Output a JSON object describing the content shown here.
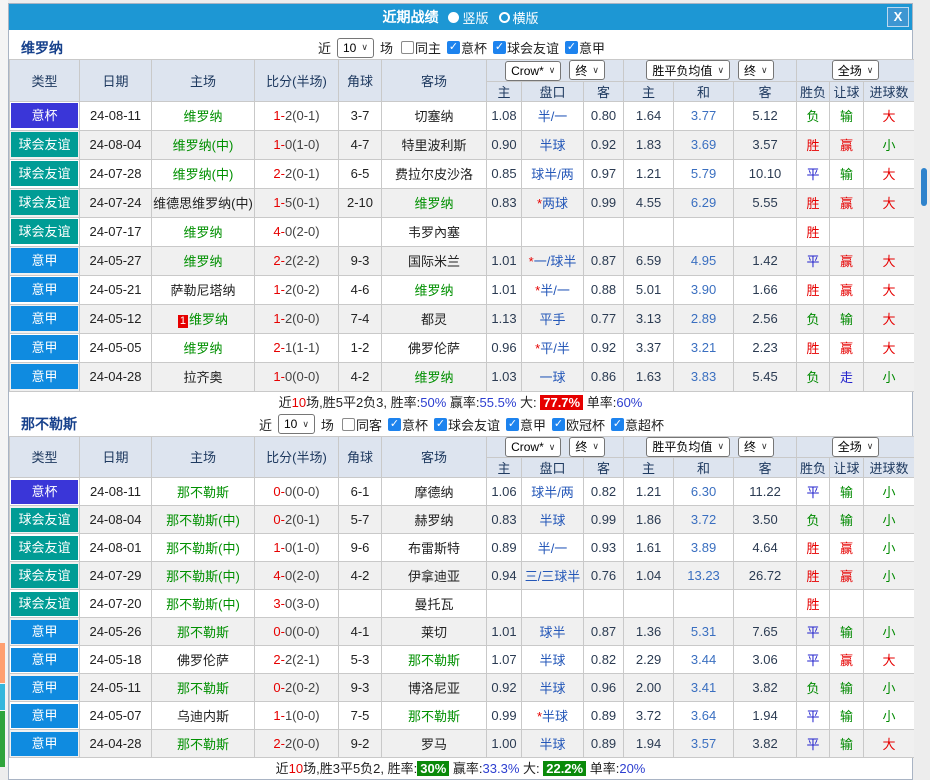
{
  "titlebar": {
    "title": "近期战绩",
    "view_options": [
      {
        "label": "竖版",
        "selected": true
      },
      {
        "label": "横版",
        "selected": false
      }
    ],
    "close_label": "X"
  },
  "table_headers": {
    "left": [
      "类型",
      "日期",
      "主场",
      "比分(半场)",
      "角球",
      "客场"
    ],
    "sub": [
      "主",
      "盘口",
      "客",
      "主",
      "和",
      "客",
      "胜负",
      "让球",
      "进球数"
    ]
  },
  "selects": {
    "odds_company": "Crow*",
    "odds_stage": "终",
    "avg_type": "胜平负均值",
    "avg_stage": "终",
    "scope": "全场"
  },
  "colors": {
    "titlebar": "#1d97d4",
    "badge_cup": "#3a36d8",
    "badge_friendly": "#009c95",
    "badge_league": "#0f8be0",
    "focus_team": "#009000",
    "win": "#e60000",
    "draw": "#2222cc",
    "lose": "#008a00"
  },
  "sections": [
    {
      "team": "维罗纳",
      "filter": {
        "prefix": "近",
        "count": "10",
        "suffix": "场",
        "same_label": "同主",
        "same_checked": false,
        "leagues": [
          {
            "label": "意杯",
            "checked": true
          },
          {
            "label": "球会友谊",
            "checked": true
          },
          {
            "label": "意甲",
            "checked": true
          }
        ]
      },
      "rows": [
        {
          "type": "意杯",
          "date": "24-08-11",
          "home": "维罗纳",
          "home_focus": true,
          "cards": "",
          "score": "1-2(0-1)",
          "corner": "3-7",
          "away": "切塞纳",
          "away_focus": false,
          "o1": "1.08",
          "star": false,
          "hcap": "半/一",
          "o2": "0.80",
          "m1": "1.64",
          "m2": "3.77",
          "m3": "5.12",
          "res": "负",
          "hres": "输",
          "gres": "大"
        },
        {
          "type": "球会友谊",
          "date": "24-08-04",
          "home": "维罗纳(中)",
          "home_focus": true,
          "cards": "",
          "score": "1-0(1-0)",
          "corner": "4-7",
          "away": "特里波利斯",
          "away_focus": false,
          "o1": "0.90",
          "star": false,
          "hcap": "半球",
          "o2": "0.92",
          "m1": "1.83",
          "m2": "3.69",
          "m3": "3.57",
          "res": "胜",
          "hres": "赢",
          "gres": "小"
        },
        {
          "type": "球会友谊",
          "date": "24-07-28",
          "home": "维罗纳(中)",
          "home_focus": true,
          "cards": "",
          "score": "2-2(0-1)",
          "corner": "6-5",
          "away": "费拉尔皮沙洛",
          "away_focus": false,
          "o1": "0.85",
          "star": false,
          "hcap": "球半/两",
          "o2": "0.97",
          "m1": "1.21",
          "m2": "5.79",
          "m3": "10.10",
          "res": "平",
          "hres": "输",
          "gres": "大"
        },
        {
          "type": "球会友谊",
          "date": "24-07-24",
          "home": "维德思维罗纳(中)",
          "home_focus": false,
          "cards": "",
          "score": "1-5(0-1)",
          "corner": "2-10",
          "away": "维罗纳",
          "away_focus": true,
          "o1": "0.83",
          "star": true,
          "hcap": "两球",
          "o2": "0.99",
          "m1": "4.55",
          "m2": "6.29",
          "m3": "5.55",
          "res": "胜",
          "hres": "赢",
          "gres": "大"
        },
        {
          "type": "球会友谊",
          "date": "24-07-17",
          "home": "维罗纳",
          "home_focus": true,
          "cards": "",
          "score": "4-0(2-0)",
          "corner": "",
          "away": "韦罗內塞",
          "away_focus": false,
          "o1": "",
          "star": false,
          "hcap": "",
          "o2": "",
          "m1": "",
          "m2": "",
          "m3": "",
          "res": "胜",
          "hres": "",
          "gres": ""
        },
        {
          "type": "意甲",
          "date": "24-05-27",
          "home": "维罗纳",
          "home_focus": true,
          "cards": "",
          "score": "2-2(2-2)",
          "corner": "9-3",
          "away": "国际米兰",
          "away_focus": false,
          "o1": "1.01",
          "star": true,
          "hcap": "一/球半",
          "o2": "0.87",
          "m1": "6.59",
          "m2": "4.95",
          "m3": "1.42",
          "res": "平",
          "hres": "赢",
          "gres": "大"
        },
        {
          "type": "意甲",
          "date": "24-05-21",
          "home": "萨勒尼塔纳",
          "home_focus": false,
          "cards": "",
          "score": "1-2(0-2)",
          "corner": "4-6",
          "away": "维罗纳",
          "away_focus": true,
          "o1": "1.01",
          "star": true,
          "hcap": "半/一",
          "o2": "0.88",
          "m1": "5.01",
          "m2": "3.90",
          "m3": "1.66",
          "res": "胜",
          "hres": "赢",
          "gres": "大"
        },
        {
          "type": "意甲",
          "date": "24-05-12",
          "home": "维罗纳",
          "home_focus": true,
          "cards": "1",
          "score": "1-2(0-0)",
          "corner": "7-4",
          "away": "都灵",
          "away_focus": false,
          "o1": "1.13",
          "star": false,
          "hcap": "平手",
          "o2": "0.77",
          "m1": "3.13",
          "m2": "2.89",
          "m3": "2.56",
          "res": "负",
          "hres": "输",
          "gres": "大"
        },
        {
          "type": "意甲",
          "date": "24-05-05",
          "home": "维罗纳",
          "home_focus": true,
          "cards": "",
          "score": "2-1(1-1)",
          "corner": "1-2",
          "away": "佛罗伦萨",
          "away_focus": false,
          "o1": "0.96",
          "star": true,
          "hcap": "平/半",
          "o2": "0.92",
          "m1": "3.37",
          "m2": "3.21",
          "m3": "2.23",
          "res": "胜",
          "hres": "赢",
          "gres": "大"
        },
        {
          "type": "意甲",
          "date": "24-04-28",
          "home": "拉齐奥",
          "home_focus": false,
          "cards": "",
          "score": "1-0(0-0)",
          "corner": "4-2",
          "away": "维罗纳",
          "away_focus": true,
          "o1": "1.03",
          "star": false,
          "hcap": "一球",
          "o2": "0.86",
          "m1": "1.63",
          "m2": "3.83",
          "m3": "5.45",
          "res": "负",
          "hres": "走",
          "gres": "小"
        }
      ],
      "summary": [
        {
          "t": "近",
          "c": "k"
        },
        {
          "t": "10",
          "c": "r"
        },
        {
          "t": "场,胜5平2负3, 胜率:",
          "c": "k"
        },
        {
          "t": "50%",
          "c": "b"
        },
        {
          "t": " 赢率:",
          "c": "k"
        },
        {
          "t": "55.5%",
          "c": "b"
        },
        {
          "t": " 大: ",
          "c": "k"
        },
        {
          "t": "77.7%",
          "c": "br"
        },
        {
          "t": " 单率:",
          "c": "k"
        },
        {
          "t": "60%",
          "c": "b"
        }
      ]
    },
    {
      "team": "那不勒斯",
      "filter": {
        "prefix": "近",
        "count": "10",
        "suffix": "场",
        "same_label": "同客",
        "same_checked": false,
        "leagues": [
          {
            "label": "意杯",
            "checked": true
          },
          {
            "label": "球会友谊",
            "checked": true
          },
          {
            "label": "意甲",
            "checked": true
          },
          {
            "label": "欧冠杯",
            "checked": true
          },
          {
            "label": "意超杯",
            "checked": true
          }
        ]
      },
      "rows": [
        {
          "type": "意杯",
          "date": "24-08-11",
          "home": "那不勒斯",
          "home_focus": true,
          "cards": "",
          "score": "0-0(0-0)",
          "corner": "6-1",
          "away": "摩德纳",
          "away_focus": false,
          "o1": "1.06",
          "star": false,
          "hcap": "球半/两",
          "o2": "0.82",
          "m1": "1.21",
          "m2": "6.30",
          "m3": "11.22",
          "res": "平",
          "hres": "输",
          "gres": "小"
        },
        {
          "type": "球会友谊",
          "date": "24-08-04",
          "home": "那不勒斯(中)",
          "home_focus": true,
          "cards": "",
          "score": "0-2(0-1)",
          "corner": "5-7",
          "away": "赫罗纳",
          "away_focus": false,
          "o1": "0.83",
          "star": false,
          "hcap": "半球",
          "o2": "0.99",
          "m1": "1.86",
          "m2": "3.72",
          "m3": "3.50",
          "res": "负",
          "hres": "输",
          "gres": "小"
        },
        {
          "type": "球会友谊",
          "date": "24-08-01",
          "home": "那不勒斯(中)",
          "home_focus": true,
          "cards": "",
          "score": "1-0(1-0)",
          "corner": "9-6",
          "away": "布雷斯特",
          "away_focus": false,
          "o1": "0.89",
          "star": false,
          "hcap": "半/一",
          "o2": "0.93",
          "m1": "1.61",
          "m2": "3.89",
          "m3": "4.64",
          "res": "胜",
          "hres": "赢",
          "gres": "小"
        },
        {
          "type": "球会友谊",
          "date": "24-07-29",
          "home": "那不勒斯(中)",
          "home_focus": true,
          "cards": "",
          "score": "4-0(2-0)",
          "corner": "4-2",
          "away": "伊拿迪亚",
          "away_focus": false,
          "o1": "0.94",
          "star": false,
          "hcap": "三/三球半",
          "o2": "0.76",
          "m1": "1.04",
          "m2": "13.23",
          "m3": "26.72",
          "res": "胜",
          "hres": "赢",
          "gres": "小"
        },
        {
          "type": "球会友谊",
          "date": "24-07-20",
          "home": "那不勒斯(中)",
          "home_focus": true,
          "cards": "",
          "score": "3-0(3-0)",
          "corner": "",
          "away": "曼托瓦",
          "away_focus": false,
          "o1": "",
          "star": false,
          "hcap": "",
          "o2": "",
          "m1": "",
          "m2": "",
          "m3": "",
          "res": "胜",
          "hres": "",
          "gres": ""
        },
        {
          "type": "意甲",
          "date": "24-05-26",
          "home": "那不勒斯",
          "home_focus": true,
          "cards": "",
          "score": "0-0(0-0)",
          "corner": "4-1",
          "away": "莱切",
          "away_focus": false,
          "o1": "1.01",
          "star": false,
          "hcap": "球半",
          "o2": "0.87",
          "m1": "1.36",
          "m2": "5.31",
          "m3": "7.65",
          "res": "平",
          "hres": "输",
          "gres": "小"
        },
        {
          "type": "意甲",
          "date": "24-05-18",
          "home": "佛罗伦萨",
          "home_focus": false,
          "cards": "",
          "score": "2-2(2-1)",
          "corner": "5-3",
          "away": "那不勒斯",
          "away_focus": true,
          "o1": "1.07",
          "star": false,
          "hcap": "半球",
          "o2": "0.82",
          "m1": "2.29",
          "m2": "3.44",
          "m3": "3.06",
          "res": "平",
          "hres": "赢",
          "gres": "大"
        },
        {
          "type": "意甲",
          "date": "24-05-11",
          "home": "那不勒斯",
          "home_focus": true,
          "cards": "",
          "score": "0-2(0-2)",
          "corner": "9-3",
          "away": "博洛尼亚",
          "away_focus": false,
          "o1": "0.92",
          "star": false,
          "hcap": "半球",
          "o2": "0.96",
          "m1": "2.00",
          "m2": "3.41",
          "m3": "3.82",
          "res": "负",
          "hres": "输",
          "gres": "小"
        },
        {
          "type": "意甲",
          "date": "24-05-07",
          "home": "乌迪内斯",
          "home_focus": false,
          "cards": "",
          "score": "1-1(0-0)",
          "corner": "7-5",
          "away": "那不勒斯",
          "away_focus": true,
          "o1": "0.99",
          "star": true,
          "hcap": "半球",
          "o2": "0.89",
          "m1": "3.72",
          "m2": "3.64",
          "m3": "1.94",
          "res": "平",
          "hres": "输",
          "gres": "小"
        },
        {
          "type": "意甲",
          "date": "24-04-28",
          "home": "那不勒斯",
          "home_focus": true,
          "cards": "",
          "score": "2-2(0-0)",
          "corner": "9-2",
          "away": "罗马",
          "away_focus": false,
          "o1": "1.00",
          "star": false,
          "hcap": "半球",
          "o2": "0.89",
          "m1": "1.94",
          "m2": "3.57",
          "m3": "3.82",
          "res": "平",
          "hres": "输",
          "gres": "大"
        }
      ],
      "summary": [
        {
          "t": "近",
          "c": "k"
        },
        {
          "t": "10",
          "c": "r"
        },
        {
          "t": "场,胜3平5负2, 胜率:",
          "c": "k"
        },
        {
          "t": "30%",
          "c": "bg"
        },
        {
          "t": " 赢率:",
          "c": "k"
        },
        {
          "t": "33.3%",
          "c": "b"
        },
        {
          "t": " 大: ",
          "c": "k"
        },
        {
          "t": "22.2%",
          "c": "bg"
        },
        {
          "t": " 单率:",
          "c": "k"
        },
        {
          "t": "20%",
          "c": "b"
        }
      ]
    }
  ]
}
